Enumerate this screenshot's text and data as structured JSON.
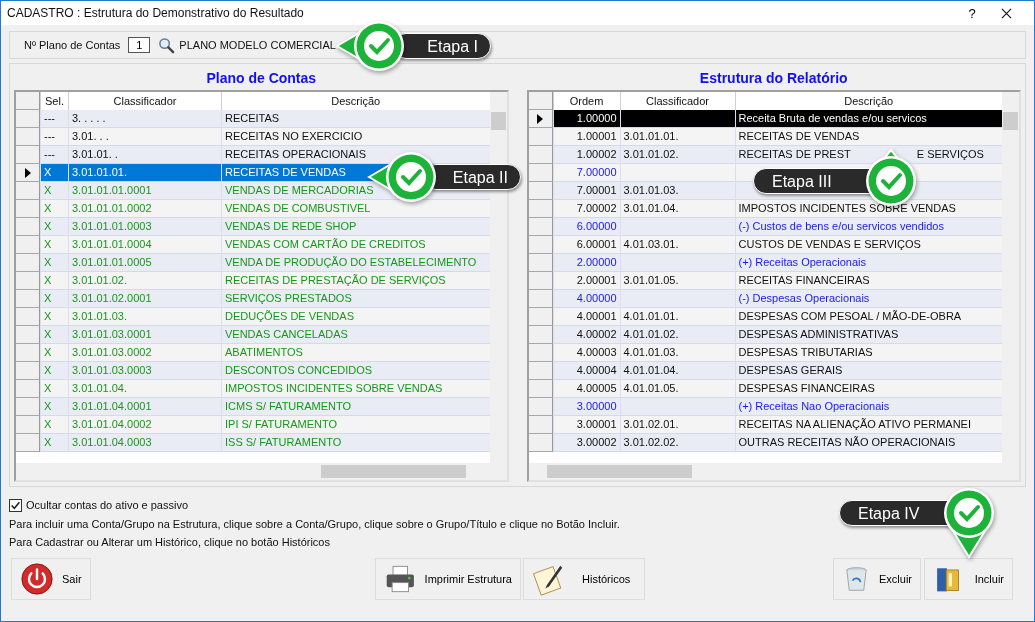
{
  "window": {
    "title": "CADASTRO : Estrutura do Demonstrativo do Resultado",
    "help": "?"
  },
  "plano": {
    "label": "Nº Plano de Contas",
    "value": "1",
    "name": "PLANO MODELO COMERCIAL"
  },
  "left": {
    "title": "Plano de Contas",
    "columns": [
      "Sel.",
      "Classificador",
      "Descrição"
    ],
    "rows": [
      {
        "sel": "---",
        "classificador": "3. . . . .",
        "descricao": "RECEITAS",
        "kind": "group",
        "selected": false
      },
      {
        "sel": "---",
        "classificador": "3.01. . .",
        "descricao": "RECEITAS NO EXERCICIO",
        "kind": "group",
        "selected": false
      },
      {
        "sel": "---",
        "classificador": "3.01.01. .",
        "descricao": "RECEITAS OPERACIONAIS",
        "kind": "group",
        "selected": false
      },
      {
        "sel": "X",
        "classificador": "3.01.01.01.",
        "descricao": "RECEITAS DE VENDAS",
        "kind": "item",
        "selected": true
      },
      {
        "sel": "X",
        "classificador": "3.01.01.01.0001",
        "descricao": "VENDAS DE MERCADORIAS",
        "kind": "item",
        "selected": false
      },
      {
        "sel": "X",
        "classificador": "3.01.01.01.0002",
        "descricao": "VENDAS DE COMBUSTIVEL",
        "kind": "item",
        "selected": false
      },
      {
        "sel": "X",
        "classificador": "3.01.01.01.0003",
        "descricao": "VENDAS DE REDE SHOP",
        "kind": "item",
        "selected": false
      },
      {
        "sel": "X",
        "classificador": "3.01.01.01.0004",
        "descricao": "VENDAS COM CARTÃO DE CREDITOS",
        "kind": "item",
        "selected": false
      },
      {
        "sel": "X",
        "classificador": "3.01.01.01.0005",
        "descricao": "VENDA DE PRODUÇÃO DO ESTABELECIMENTO",
        "kind": "item",
        "selected": false
      },
      {
        "sel": "X",
        "classificador": "3.01.01.02.",
        "descricao": "RECEITAS DE PRESTAÇÃO DE SERVIÇOS",
        "kind": "item",
        "selected": false
      },
      {
        "sel": "X",
        "classificador": "3.01.01.02.0001",
        "descricao": "SERVIÇOS PRESTADOS",
        "kind": "item",
        "selected": false
      },
      {
        "sel": "X",
        "classificador": "3.01.01.03.",
        "descricao": "DEDUÇÕES DE VENDAS",
        "kind": "item",
        "selected": false
      },
      {
        "sel": "X",
        "classificador": "3.01.01.03.0001",
        "descricao": "VENDAS CANCELADAS",
        "kind": "item",
        "selected": false
      },
      {
        "sel": "X",
        "classificador": "3.01.01.03.0002",
        "descricao": "ABATIMENTOS",
        "kind": "item",
        "selected": false
      },
      {
        "sel": "X",
        "classificador": "3.01.01.03.0003",
        "descricao": "DESCONTOS CONCEDIDOS",
        "kind": "item",
        "selected": false
      },
      {
        "sel": "X",
        "classificador": "3.01.01.04.",
        "descricao": "IMPOSTOS INCIDENTES SOBRE VENDAS",
        "kind": "item",
        "selected": false
      },
      {
        "sel": "X",
        "classificador": "3.01.01.04.0001",
        "descricao": "ICMS S/ FATURAMENTO",
        "kind": "item",
        "selected": false
      },
      {
        "sel": "X",
        "classificador": "3.01.01.04.0002",
        "descricao": "IPI S/ FATURAMENTO",
        "kind": "item",
        "selected": false
      },
      {
        "sel": "X",
        "classificador": "3.01.01.04.0003",
        "descricao": "ISS S/ FATURAMENTO",
        "kind": "item",
        "selected": false
      }
    ]
  },
  "right": {
    "title": "Estrutura do Relatório",
    "columns": [
      "Ordem",
      "Classificador",
      "Descrição"
    ],
    "rows": [
      {
        "ordem": "1.00000",
        "descricao": "Receita Bruta de vendas e/ou servicos",
        "kind": "group",
        "selected": true
      },
      {
        "ordem": "1.00001",
        "classificador": "3.01.01.01.",
        "descricao": "RECEITAS DE VENDAS",
        "kind": "item",
        "selected": false
      },
      {
        "ordem": "1.00002",
        "classificador": "3.01.01.02.",
        "descricao": "RECEITAS DE PREST",
        "descricao_after": "E SERVIÇOS",
        "kind": "item",
        "selected": false
      },
      {
        "ordem": "7.00000",
        "kind": "group",
        "selected": false
      },
      {
        "ordem": "7.00001",
        "classificador": "3.01.01.03.",
        "kind": "item",
        "selected": false
      },
      {
        "ordem": "7.00002",
        "classificador": "3.01.01.04.",
        "descricao": "IMPOSTOS INCIDENTES SOBRE VENDAS",
        "kind": "item",
        "selected": false
      },
      {
        "ordem": "6.00000",
        "descricao": "(-) Custos de bens e/ou servicos vendidos",
        "kind": "group",
        "selected": false
      },
      {
        "ordem": "6.00001",
        "classificador": "4.01.03.01.",
        "descricao": "CUSTOS DE VENDAS E SERVIÇOS",
        "kind": "item",
        "selected": false
      },
      {
        "ordem": "2.00000",
        "descricao": "(+) Receitas Operacionais",
        "kind": "group",
        "selected": false
      },
      {
        "ordem": "2.00001",
        "classificador": "3.01.01.05.",
        "descricao": "RECEITAS FINANCEIRAS",
        "kind": "item",
        "selected": false
      },
      {
        "ordem": "4.00000",
        "descricao": "(-) Despesas Operacionais",
        "kind": "group",
        "selected": false
      },
      {
        "ordem": "4.00001",
        "classificador": "4.01.01.01.",
        "descricao": "DESPESAS COM PESOAL / MÃO-DE-OBRA",
        "kind": "item",
        "selected": false
      },
      {
        "ordem": "4.00002",
        "classificador": "4.01.01.02.",
        "descricao": "DESPESAS ADMINISTRATIVAS",
        "kind": "item",
        "selected": false
      },
      {
        "ordem": "4.00003",
        "classificador": "4.01.01.03.",
        "descricao": "DESPESAS TRIBUTARIAS",
        "kind": "item",
        "selected": false
      },
      {
        "ordem": "4.00004",
        "classificador": "4.01.01.04.",
        "descricao": "DESPESAS GERAIS",
        "kind": "item",
        "selected": false
      },
      {
        "ordem": "4.00005",
        "classificador": "4.01.01.05.",
        "descricao": "DESPESAS FINANCEIRAS",
        "kind": "item",
        "selected": false
      },
      {
        "ordem": "3.00000",
        "descricao": "(+) Receitas Nao Operacionais",
        "kind": "group",
        "selected": false
      },
      {
        "ordem": "3.00001",
        "classificador": "3.01.02.01.",
        "descricao": "RECEITAS NA ALIENAÇÃO ATIVO PERMANEI",
        "kind": "item",
        "selected": false
      },
      {
        "ordem": "3.00002",
        "classificador": "3.01.02.02.",
        "descricao": "OUTRAS RECEITAS NÃO OPERACIONAIS",
        "kind": "item",
        "selected": false
      }
    ]
  },
  "hide_option": {
    "label": "Ocultar contas do ativo e passivo",
    "checked": true
  },
  "help_lines": [
    "Para incluir uma Conta/Grupo na Estrutura, clique sobre a Conta/Grupo, clique sobre o Grupo/Título e clique no Botão Incluir.",
    "Para Cadastrar ou Alterar um Histórico, clique no botão Históricos"
  ],
  "buttons": [
    {
      "label": "Sair",
      "kind": "exit"
    },
    {
      "label": "Imprimir Estrutura",
      "kind": "print"
    },
    {
      "label": "Históricos",
      "kind": "history"
    },
    {
      "label": "Excluir",
      "kind": "delete"
    },
    {
      "label": "Incluir",
      "kind": "add"
    }
  ],
  "callouts": [
    {
      "label": "Etapa I"
    },
    {
      "label": "Etapa II"
    },
    {
      "label": "Etapa III"
    },
    {
      "label": "Etapa IV"
    }
  ]
}
